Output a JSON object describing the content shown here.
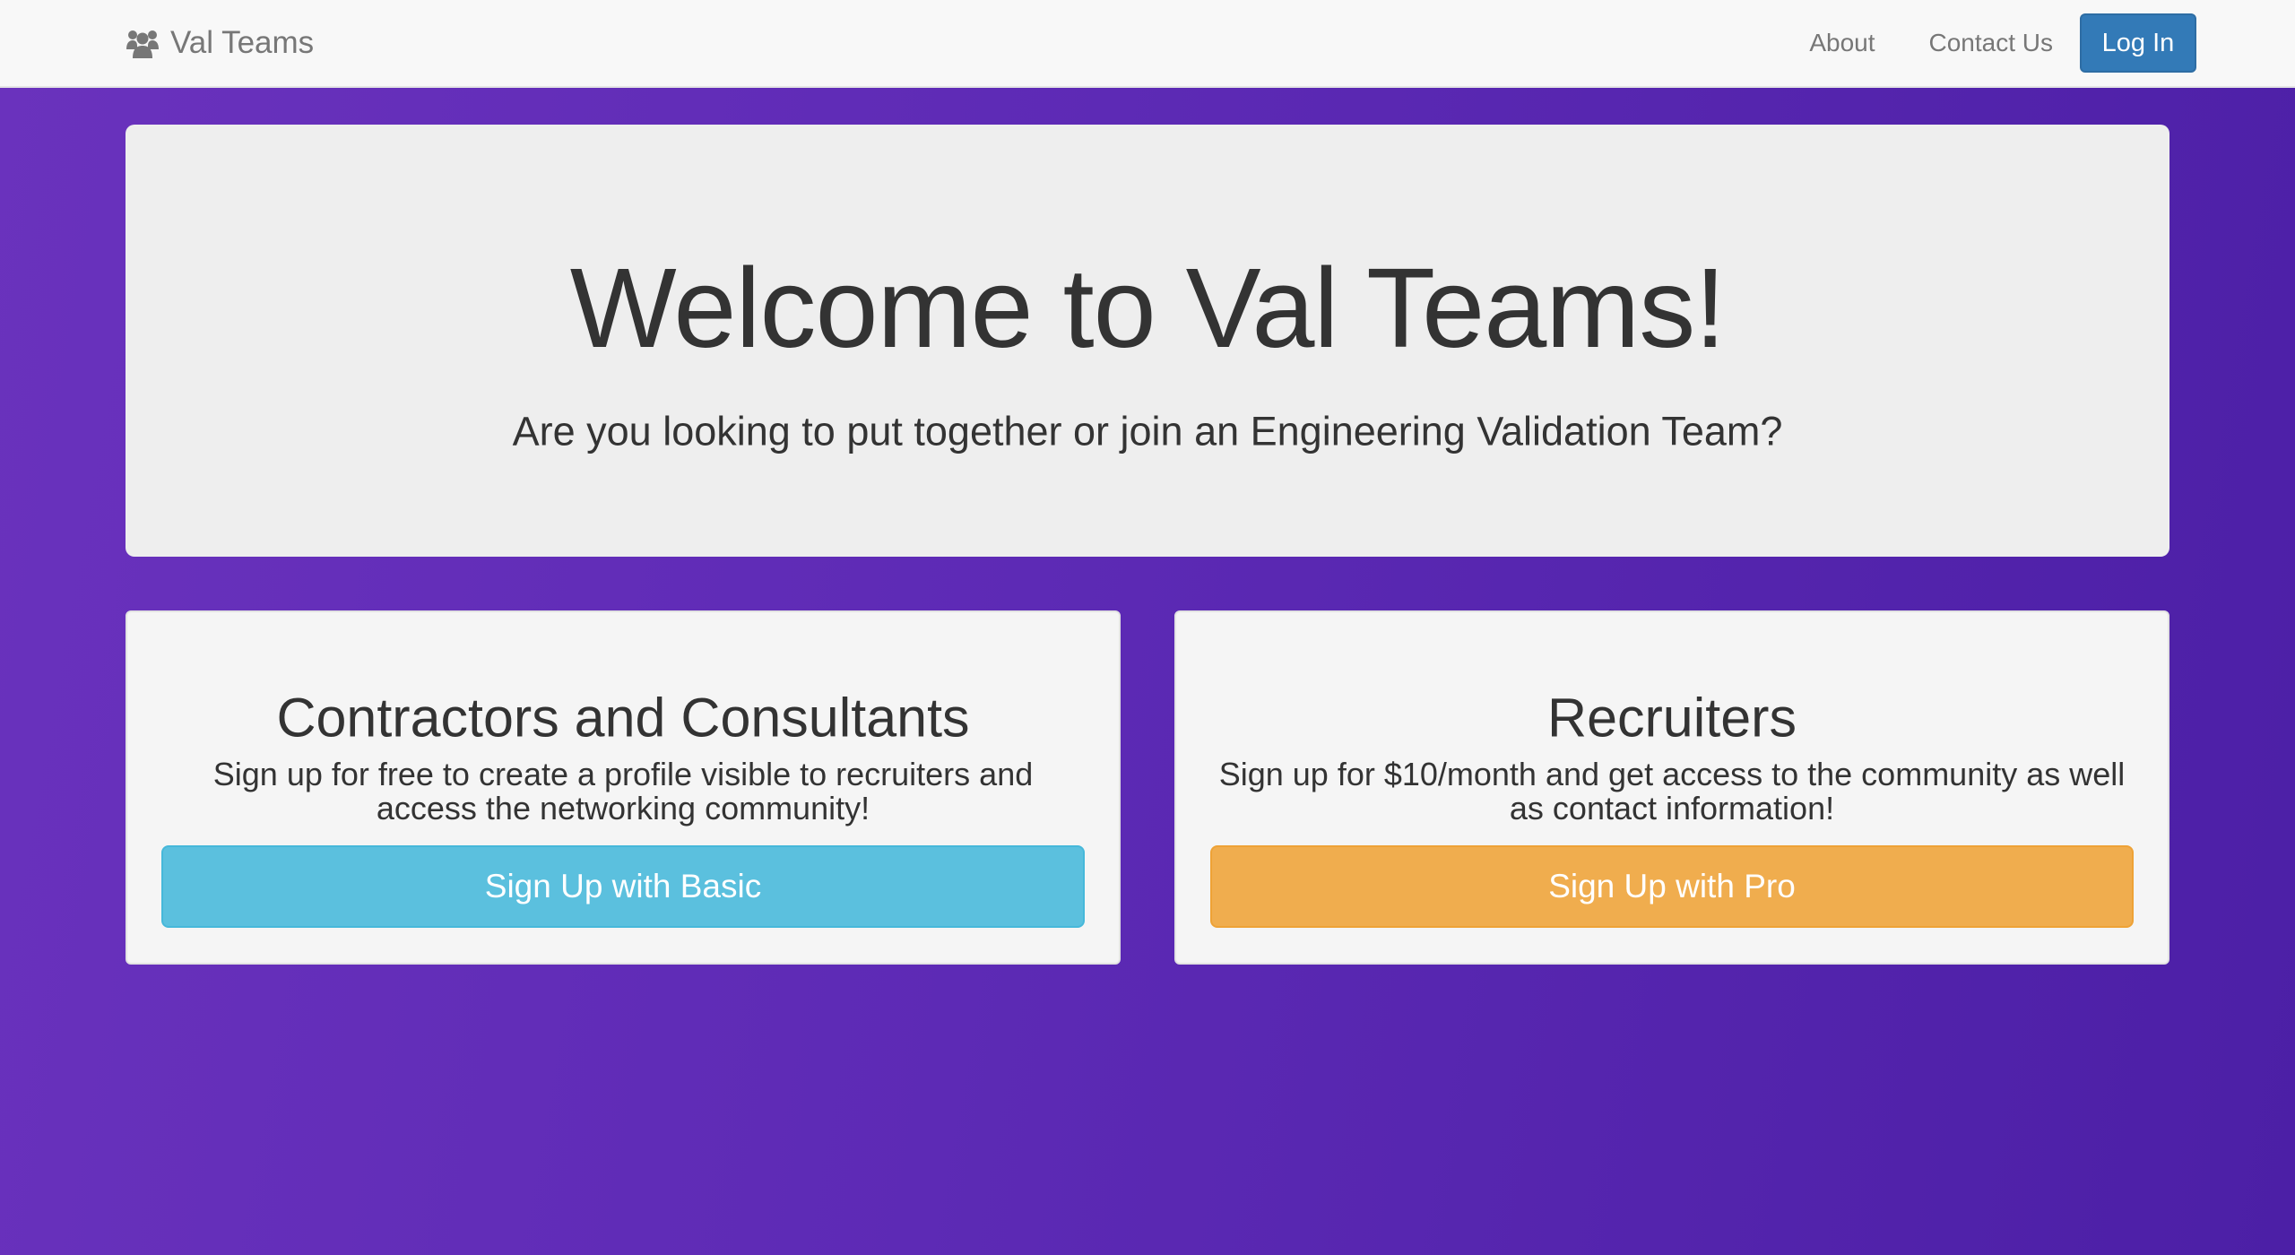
{
  "navbar": {
    "brand": {
      "icon": "users-icon",
      "label": "Val Teams"
    },
    "links": [
      {
        "label": "About"
      },
      {
        "label": "Contact Us"
      }
    ],
    "login_label": "Log In"
  },
  "hero": {
    "title": "Welcome to Val Teams!",
    "subtitle": "Are you looking to put together or join an Engineering Validation Team?"
  },
  "plans": [
    {
      "title": "Contractors and Consultants",
      "description": "Sign up for free to create a profile visible to recruiters and access the networking community!",
      "button_label": "Sign Up with Basic",
      "button_color": "#5bc0de"
    },
    {
      "title": "Recruiters",
      "description": "Sign up for $10/month and get access to the community as well as contact information!",
      "button_label": "Sign Up with Pro",
      "button_color": "#f0ad4e"
    }
  ],
  "colors": {
    "background_start": "#6a32bd",
    "background_end": "#4c1fa6",
    "primary": "#337ab7",
    "navbar_text": "#777777"
  }
}
